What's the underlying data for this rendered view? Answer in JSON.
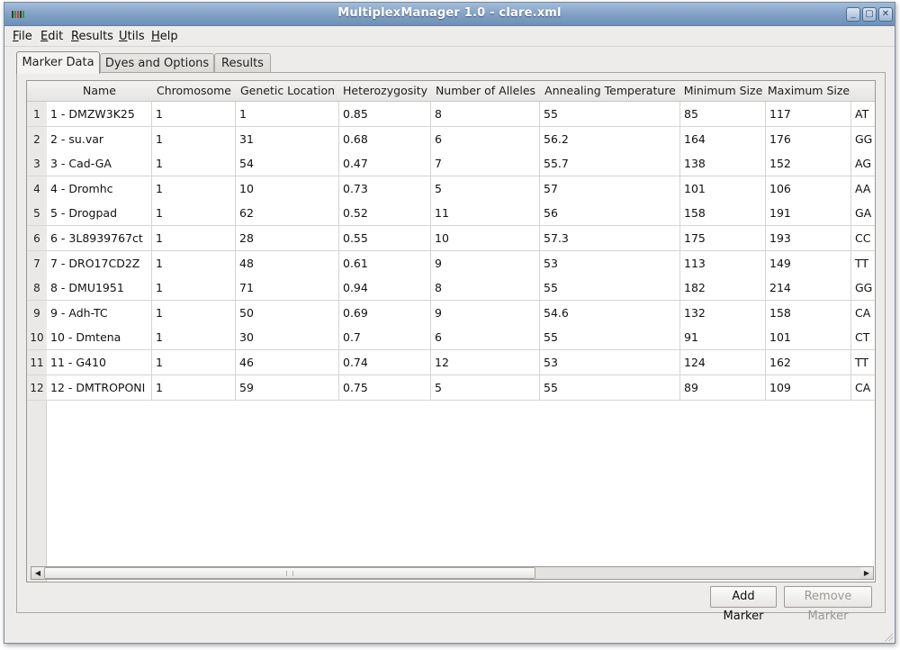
{
  "window": {
    "title": "MultiplexManager 1.0 - clare.xml",
    "controls": [
      "minimize",
      "maximize",
      "close"
    ]
  },
  "menubar": {
    "items": [
      {
        "label": "File",
        "mnemonic": "F"
      },
      {
        "label": "Edit",
        "mnemonic": "E"
      },
      {
        "label": "Results",
        "mnemonic": "R"
      },
      {
        "label": "Utils",
        "mnemonic": "U"
      },
      {
        "label": "Help",
        "mnemonic": "H"
      }
    ]
  },
  "tabs": [
    {
      "label": "Marker Data",
      "active": true
    },
    {
      "label": "Dyes and Options",
      "active": false
    },
    {
      "label": "Results",
      "active": false
    }
  ],
  "table": {
    "columns": [
      "Name",
      "Chromosome",
      "Genetic Location",
      "Heterozygosity",
      "Number of Alleles",
      "Annealing Temperature",
      "Minimum Size",
      "Maximum Size",
      ""
    ],
    "rows": [
      {
        "num": "1",
        "cells": [
          "1 - DMZW3K25",
          "1",
          "1",
          "0.85",
          "8",
          "55",
          "85",
          "117",
          "AT"
        ]
      },
      {
        "num": "2",
        "cells": [
          "2 - su.var",
          "1",
          "31",
          "0.68",
          "6",
          "56.2",
          "164",
          "176",
          "GG"
        ]
      },
      {
        "num": "3",
        "cells": [
          "3 - Cad-GA",
          "1",
          "54",
          "0.47",
          "7",
          "55.7",
          "138",
          "152",
          "AG"
        ]
      },
      {
        "num": "4",
        "cells": [
          "4 - Dromhc",
          "1",
          "10",
          "0.73",
          "5",
          "57",
          "101",
          "106",
          "AA"
        ]
      },
      {
        "num": "5",
        "cells": [
          "5 - Drogpad",
          "1",
          "62",
          "0.52",
          "11",
          "56",
          "158",
          "191",
          "GA"
        ]
      },
      {
        "num": "6",
        "cells": [
          "6 - 3L8939767ct",
          "1",
          "28",
          "0.55",
          "10",
          "57.3",
          "175",
          "193",
          "CC"
        ]
      },
      {
        "num": "7",
        "cells": [
          "7 - DRO17CD2Z",
          "1",
          "48",
          "0.61",
          "9",
          "53",
          "113",
          "149",
          "TT"
        ]
      },
      {
        "num": "8",
        "cells": [
          "8 - DMU1951",
          "1",
          "71",
          "0.94",
          "8",
          "55",
          "182",
          "214",
          "GG"
        ]
      },
      {
        "num": "9",
        "cells": [
          "9 - Adh-TC",
          "1",
          "50",
          "0.69",
          "9",
          "54.6",
          "132",
          "158",
          "CA"
        ]
      },
      {
        "num": "10",
        "cells": [
          "10 - Dmtena",
          "1",
          "30",
          "0.7",
          "6",
          "55",
          "91",
          "101",
          "CT"
        ]
      },
      {
        "num": "11",
        "cells": [
          "11 - G410",
          "1",
          "46",
          "0.74",
          "12",
          "53",
          "124",
          "162",
          "TT"
        ]
      },
      {
        "num": "12",
        "cells": [
          "12 - DMTROPONI",
          "1",
          "59",
          "0.75",
          "5",
          "55",
          "89",
          "109",
          "CA"
        ]
      }
    ]
  },
  "buttons": {
    "add_marker": "Add Marker",
    "remove_marker": "Remove Marker"
  }
}
